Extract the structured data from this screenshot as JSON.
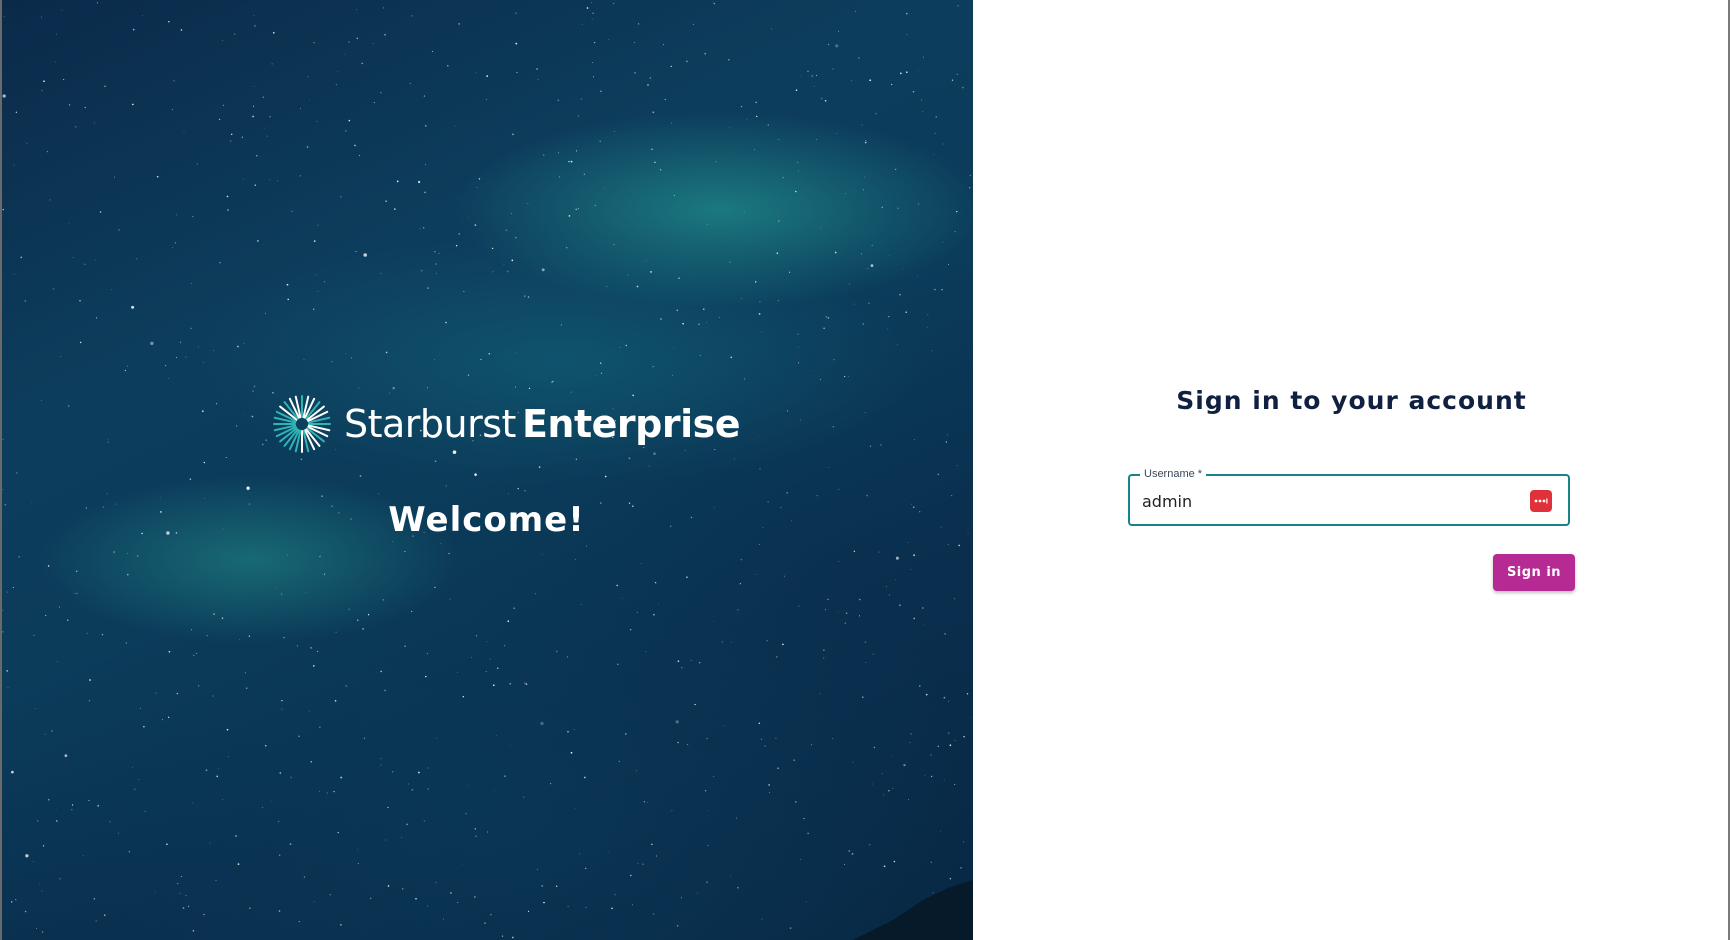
{
  "hero": {
    "brand_light": "Starburst",
    "brand_bold": "Enterprise",
    "welcome": "Welcome!"
  },
  "signin": {
    "title": "Sign in to your account",
    "username_label": "Username *",
    "username_value": "admin",
    "submit_label": "Sign in"
  },
  "icons": {
    "brand_logo": "starburst-logo-icon",
    "password_manager": "password-manager-icon"
  },
  "colors": {
    "accent": "#17848c",
    "button": "#b62a94",
    "title": "#0f2040",
    "password_manager": "#e0303a"
  }
}
